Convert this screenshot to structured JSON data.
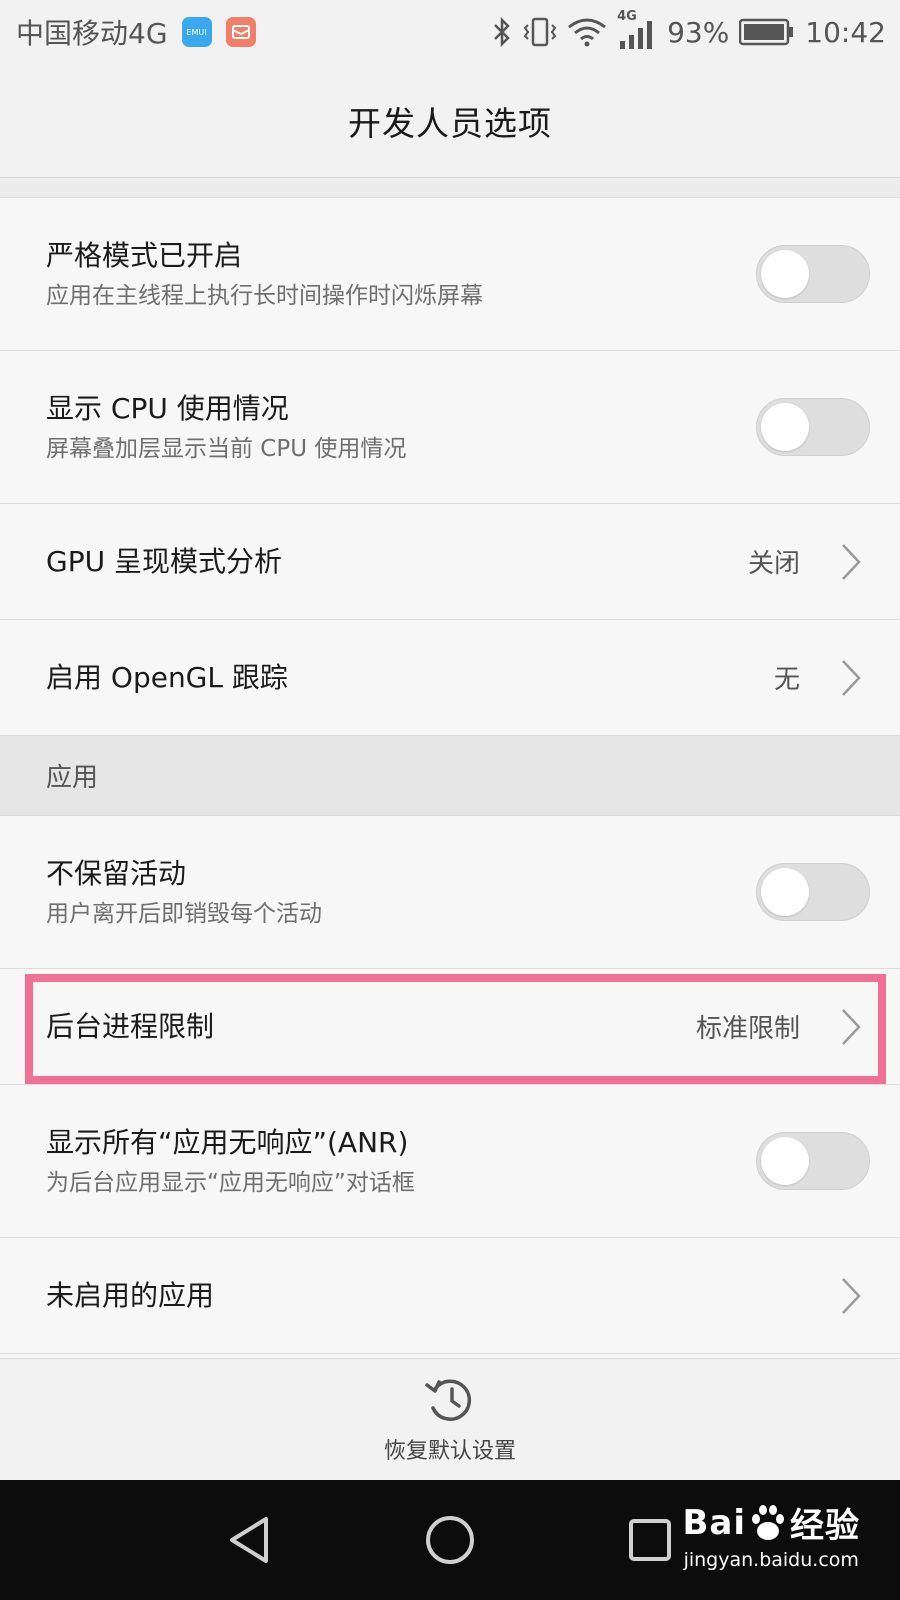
{
  "status_bar": {
    "carrier": "中国移动4G",
    "notif_1_text": "EMUI",
    "notif_colors": [
      "#3aa8ef",
      "#f07f6a"
    ],
    "network_label": "4G",
    "battery": "93%",
    "time": "10:42"
  },
  "header": {
    "title": "开发人员选项"
  },
  "rows_top": [
    {
      "title": "严格模式已开启",
      "subtitle": "应用在主线程上执行长时间操作时闪烁屏幕",
      "toggle_on": false
    },
    {
      "title": "显示 CPU 使用情况",
      "subtitle": "屏幕叠加层显示当前 CPU 使用情况",
      "toggle_on": false
    },
    {
      "title": "GPU 呈现模式分析",
      "value": "关闭"
    },
    {
      "title": "启用 OpenGL 跟踪",
      "value": "无"
    }
  ],
  "section_apps": {
    "label": "应用"
  },
  "rows_apps": [
    {
      "title": "不保留活动",
      "subtitle": "用户离开后即销毁每个活动",
      "toggle_on": false
    },
    {
      "title": "后台进程限制",
      "value": "标准限制"
    },
    {
      "title": "显示所有“应用无响应”(ANR)",
      "subtitle": "为后台应用显示“应用无响应”对话框",
      "toggle_on": false
    },
    {
      "title": "未启用的应用"
    }
  ],
  "restore": {
    "label": "恢复默认设置",
    "icon": "history-icon"
  },
  "nav_bar": {
    "icons": [
      "back-icon",
      "home-icon",
      "recents-icon"
    ]
  },
  "watermark": {
    "brand_left": "Bai",
    "brand_right": "经验",
    "url": "jingyan.baidu.com"
  },
  "colors": {
    "highlight": "#f07096",
    "toggle_off": "#dedede",
    "nav_bg": "#0c0c0c"
  }
}
